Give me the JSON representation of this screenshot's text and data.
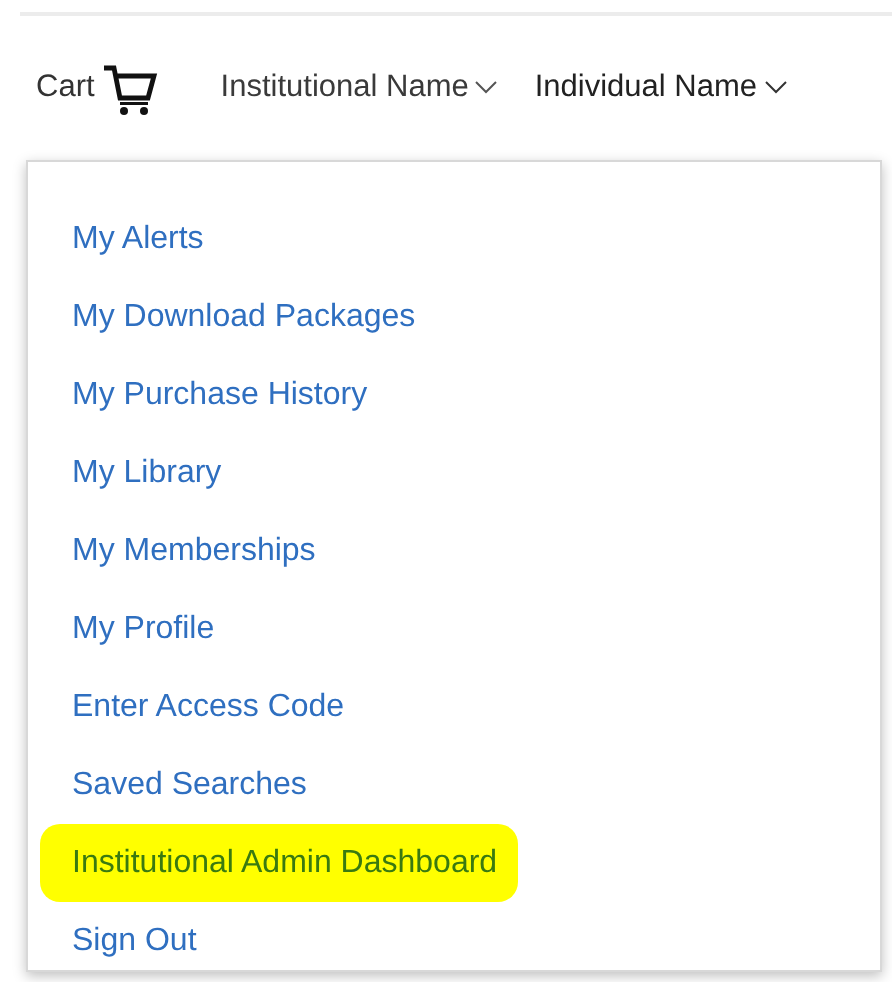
{
  "nav": {
    "cart": {
      "label": "Cart"
    },
    "menus": [
      {
        "label": "Institutional Name",
        "expanded": false
      },
      {
        "label": "Individual Name",
        "expanded": true
      }
    ]
  },
  "dropdown": {
    "items": [
      {
        "label": "My Alerts",
        "highlighted": false
      },
      {
        "label": "My Download Packages",
        "highlighted": false
      },
      {
        "label": "My Purchase History",
        "highlighted": false
      },
      {
        "label": "My Library",
        "highlighted": false
      },
      {
        "label": "My Memberships",
        "highlighted": false
      },
      {
        "label": "My Profile",
        "highlighted": false
      },
      {
        "label": "Enter Access Code",
        "highlighted": false
      },
      {
        "label": "Saved Searches",
        "highlighted": false
      },
      {
        "label": "Institutional Admin Dashboard",
        "highlighted": true
      },
      {
        "label": "Sign Out",
        "highlighted": false
      }
    ]
  }
}
